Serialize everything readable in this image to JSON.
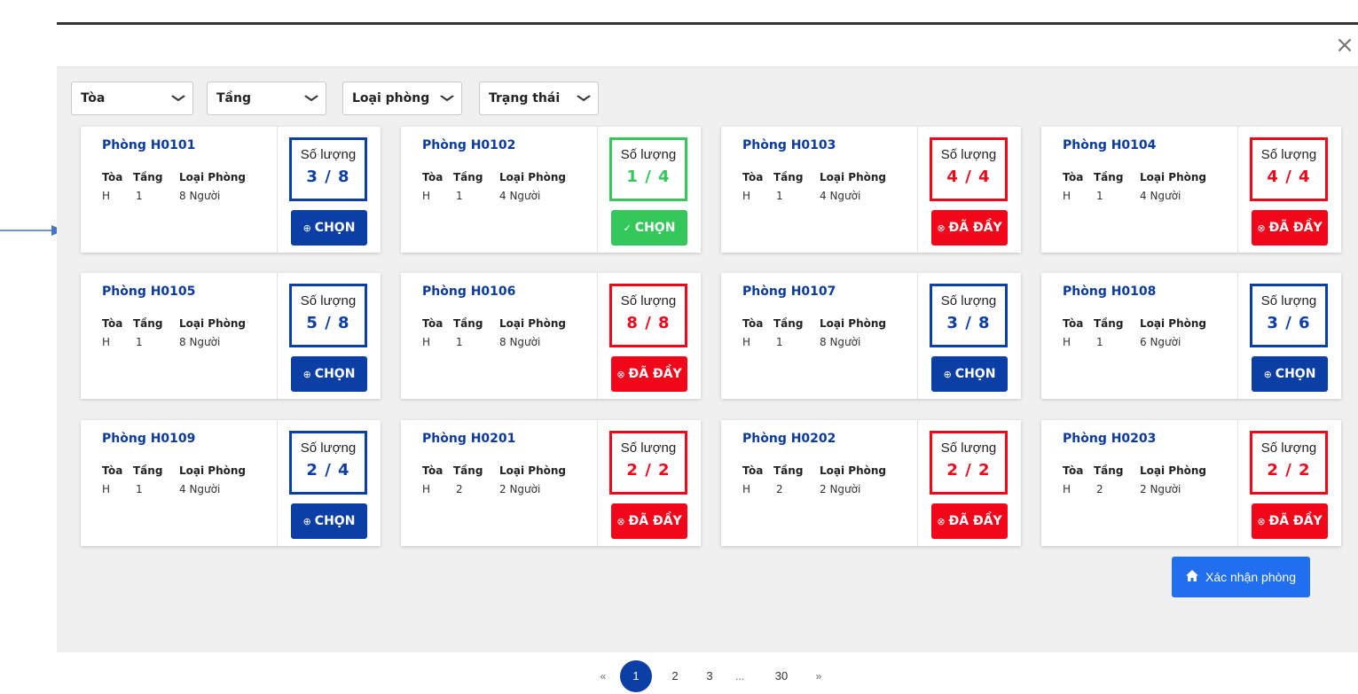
{
  "modal": {
    "close_icon": "×"
  },
  "filters": [
    {
      "label": "Tòa"
    },
    {
      "label": "Tầng"
    },
    {
      "label": "Loại phòng"
    },
    {
      "label": "Trạng thái"
    }
  ],
  "filter_chevron": "⌄",
  "colors": {
    "blue": "#0b3fa5",
    "green": "#34c759",
    "red": "#f2061a",
    "confirm": "#1f6ff0"
  },
  "card_headers": {
    "toa": "Tòa",
    "tang": "Tầng",
    "loai": "Loại Phòng",
    "qty_label": "Số lượng"
  },
  "rooms": [
    {
      "name": "Phòng H0101",
      "toa": "H",
      "tang": "1",
      "loai": "8 Người",
      "qty": "3 / 8",
      "state": "available",
      "button": "CHỌN",
      "icon": "⊕"
    },
    {
      "name": "Phòng H0102",
      "toa": "H",
      "tang": "1",
      "loai": "4 Người",
      "qty": "1 / 4",
      "state": "selected",
      "button": "CHỌN",
      "icon": "✓"
    },
    {
      "name": "Phòng H0103",
      "toa": "H",
      "tang": "1",
      "loai": "4 Người",
      "qty": "4 / 4",
      "state": "full",
      "button": "ĐÃ ĐẦY",
      "icon": "⊗"
    },
    {
      "name": "Phòng H0104",
      "toa": "H",
      "tang": "1",
      "loai": "4 Người",
      "qty": "4 / 4",
      "state": "full",
      "button": "ĐÃ ĐẦY",
      "icon": "⊗"
    },
    {
      "name": "Phòng H0105",
      "toa": "H",
      "tang": "1",
      "loai": "8 Người",
      "qty": "5 / 8",
      "state": "available",
      "button": "CHỌN",
      "icon": "⊕"
    },
    {
      "name": "Phòng H0106",
      "toa": "H",
      "tang": "1",
      "loai": "8 Người",
      "qty": "8 / 8",
      "state": "full",
      "button": "ĐÃ ĐẦY",
      "icon": "⊗"
    },
    {
      "name": "Phòng H0107",
      "toa": "H",
      "tang": "1",
      "loai": "8 Người",
      "qty": "3 / 8",
      "state": "available",
      "button": "CHỌN",
      "icon": "⊕"
    },
    {
      "name": "Phòng H0108",
      "toa": "H",
      "tang": "1",
      "loai": "6 Người",
      "qty": "3 / 6",
      "state": "available",
      "button": "CHỌN",
      "icon": "⊕"
    },
    {
      "name": "Phòng H0109",
      "toa": "H",
      "tang": "1",
      "loai": "4 Người",
      "qty": "2 / 4",
      "state": "available",
      "button": "CHỌN",
      "icon": "⊕"
    },
    {
      "name": "Phòng H0201",
      "toa": "H",
      "tang": "2",
      "loai": "2 Người",
      "qty": "2 / 2",
      "state": "full",
      "button": "ĐÃ ĐẦY",
      "icon": "⊗"
    },
    {
      "name": "Phòng H0202",
      "toa": "H",
      "tang": "2",
      "loai": "2 Người",
      "qty": "2 / 2",
      "state": "full",
      "button": "ĐÃ ĐẦY",
      "icon": "⊗"
    },
    {
      "name": "Phòng H0203",
      "toa": "H",
      "tang": "2",
      "loai": "2 Người",
      "qty": "2 / 2",
      "state": "full",
      "button": "ĐÃ ĐẦY",
      "icon": "⊗"
    }
  ],
  "confirm": {
    "label": "Xác nhận phòng",
    "icon": "home-icon"
  },
  "pagination": {
    "prev": "«",
    "pages": [
      "1",
      "2",
      "3",
      "...",
      "30"
    ],
    "active": "1",
    "next": "»"
  }
}
